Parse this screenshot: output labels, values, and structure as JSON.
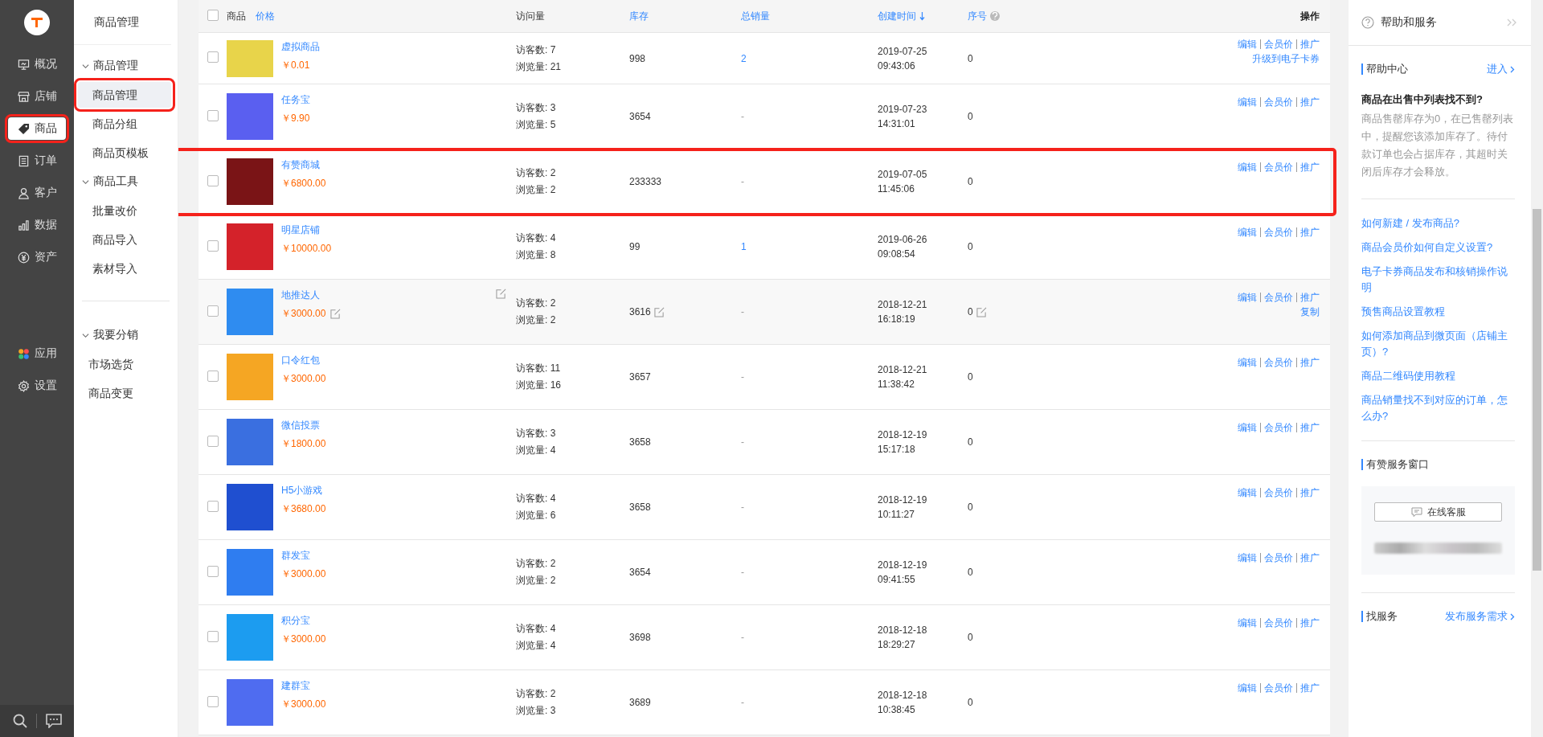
{
  "main_nav": {
    "sections": [
      {
        "items": [
          {
            "label": "概况",
            "selected": false,
            "highlighted": false
          },
          {
            "label": "店铺",
            "selected": false,
            "highlighted": false
          },
          {
            "label": "商品",
            "selected": true,
            "highlighted": true
          },
          {
            "label": "订单",
            "selected": false,
            "highlighted": false
          },
          {
            "label": "客户",
            "selected": false,
            "highlighted": false
          },
          {
            "label": "数据",
            "selected": false,
            "highlighted": false
          },
          {
            "label": "资产",
            "selected": false,
            "highlighted": false
          }
        ]
      },
      {
        "items": [
          {
            "label": "应用",
            "selected": false,
            "highlighted": false
          },
          {
            "label": "设置",
            "selected": false,
            "highlighted": false
          }
        ]
      }
    ]
  },
  "sub_nav": {
    "title": "商品管理",
    "sections": [
      {
        "groups": [
          {
            "label": "商品管理",
            "expanded": true,
            "items": [
              {
                "label": "商品管理",
                "selected": true,
                "highlighted": true
              },
              {
                "label": "商品分组",
                "selected": false,
                "highlighted": false
              },
              {
                "label": "商品页模板",
                "selected": false,
                "highlighted": false
              }
            ]
          },
          {
            "label": "商品工具",
            "expanded": true,
            "items": [
              {
                "label": "批量改价",
                "selected": false,
                "highlighted": false
              },
              {
                "label": "商品导入",
                "selected": false,
                "highlighted": false
              },
              {
                "label": "素材导入",
                "selected": false,
                "highlighted": false
              }
            ]
          }
        ]
      },
      {
        "groups": [
          {
            "label": "我要分销",
            "expanded": true,
            "items": [
              {
                "label": "市场选货",
                "selected": false,
                "highlighted": false
              },
              {
                "label": "商品变更",
                "selected": false,
                "highlighted": false
              }
            ]
          }
        ]
      }
    ]
  },
  "table": {
    "select_all_checked": false,
    "columns": [
      {
        "label": "商品",
        "sortable": false,
        "sorted_desc": false,
        "help": false
      },
      {
        "label": "价格",
        "sortable": true,
        "sorted_desc": false,
        "help": false
      },
      {
        "label": "访问量",
        "sortable": false,
        "sorted_desc": false,
        "help": false
      },
      {
        "label": "库存",
        "sortable": true,
        "sorted_desc": false,
        "help": false
      },
      {
        "label": "总销量",
        "sortable": true,
        "sorted_desc": false,
        "help": false
      },
      {
        "label": "创建时间",
        "sortable": true,
        "sorted_desc": true,
        "help": false
      },
      {
        "label": "序号",
        "sortable": true,
        "sorted_desc": false,
        "help": true
      },
      {
        "label": "操作",
        "sortable": false,
        "sorted_desc": false,
        "help": false
      }
    ],
    "rows": [
      {
        "name": "虚拟商品",
        "price": "￥0.01",
        "color": "#e8d44a",
        "visitors": "访客数: 7",
        "views": "浏览量: 21",
        "stock": "998",
        "sales": "2",
        "sales_linked": true,
        "date": "2019-07-25",
        "time": "09:43:06",
        "seq": "0",
        "actions": [
          "编辑",
          "会员价",
          "推广"
        ],
        "extra_actions": [
          "升级到电子卡券"
        ],
        "highlighted": false,
        "hovered": false,
        "checked": false
      },
      {
        "name": "任务宝",
        "price": "￥9.90",
        "color": "#5a5ff0",
        "visitors": "访客数: 3",
        "views": "浏览量: 5",
        "stock": "3654",
        "sales": "-",
        "sales_linked": false,
        "date": "2019-07-23",
        "time": "14:31:01",
        "seq": "0",
        "actions": [
          "编辑",
          "会员价",
          "推广"
        ],
        "extra_actions": [],
        "highlighted": false,
        "hovered": false,
        "checked": false
      },
      {
        "name": "有赞商城",
        "price": "￥6800.00",
        "color": "#7a1416",
        "visitors": "访客数: 2",
        "views": "浏览量: 2",
        "stock": "233333",
        "sales": "-",
        "sales_linked": false,
        "date": "2019-07-05",
        "time": "11:45:06",
        "seq": "0",
        "actions": [
          "编辑",
          "会员价",
          "推广"
        ],
        "extra_actions": [],
        "highlighted": true,
        "hovered": false,
        "checked": false
      },
      {
        "name": "明星店铺",
        "price": "￥10000.00",
        "color": "#d4222a",
        "visitors": "访客数: 4",
        "views": "浏览量: 8",
        "stock": "99",
        "sales": "1",
        "sales_linked": true,
        "date": "2019-06-26",
        "time": "09:08:54",
        "seq": "0",
        "actions": [
          "编辑",
          "会员价",
          "推广"
        ],
        "extra_actions": [],
        "highlighted": false,
        "hovered": false,
        "checked": false
      },
      {
        "name": "地推达人",
        "price": "￥3000.00",
        "color": "#2f8cf0",
        "visitors": "访客数: 2",
        "views": "浏览量: 2",
        "stock": "3616",
        "sales": "-",
        "sales_linked": false,
        "date": "2018-12-21",
        "time": "16:18:19",
        "seq": "0",
        "actions": [
          "编辑",
          "会员价",
          "推广"
        ],
        "extra_actions": [
          "复制"
        ],
        "highlighted": false,
        "hovered": true,
        "checked": false
      },
      {
        "name": "口令红包",
        "price": "￥3000.00",
        "color": "#f5a623",
        "visitors": "访客数: 11",
        "views": "浏览量: 16",
        "stock": "3657",
        "sales": "-",
        "sales_linked": false,
        "date": "2018-12-21",
        "time": "11:38:42",
        "seq": "0",
        "actions": [
          "编辑",
          "会员价",
          "推广"
        ],
        "extra_actions": [],
        "highlighted": false,
        "hovered": false,
        "checked": false
      },
      {
        "name": "微信投票",
        "price": "￥1800.00",
        "color": "#3a6fe0",
        "visitors": "访客数: 3",
        "views": "浏览量: 4",
        "stock": "3658",
        "sales": "-",
        "sales_linked": false,
        "date": "2018-12-19",
        "time": "15:17:18",
        "seq": "0",
        "actions": [
          "编辑",
          "会员价",
          "推广"
        ],
        "extra_actions": [],
        "highlighted": false,
        "hovered": false,
        "checked": false
      },
      {
        "name": "H5小游戏",
        "price": "￥3680.00",
        "color": "#1f4fd0",
        "visitors": "访客数: 4",
        "views": "浏览量: 6",
        "stock": "3658",
        "sales": "-",
        "sales_linked": false,
        "date": "2018-12-19",
        "time": "10:11:27",
        "seq": "0",
        "actions": [
          "编辑",
          "会员价",
          "推广"
        ],
        "extra_actions": [],
        "highlighted": false,
        "hovered": false,
        "checked": false
      },
      {
        "name": "群发宝",
        "price": "￥3000.00",
        "color": "#2f7df0",
        "visitors": "访客数: 2",
        "views": "浏览量: 2",
        "stock": "3654",
        "sales": "-",
        "sales_linked": false,
        "date": "2018-12-19",
        "time": "09:41:55",
        "seq": "0",
        "actions": [
          "编辑",
          "会员价",
          "推广"
        ],
        "extra_actions": [],
        "highlighted": false,
        "hovered": false,
        "checked": false
      },
      {
        "name": "积分宝",
        "price": "￥3000.00",
        "color": "#1c9cf0",
        "visitors": "访客数: 4",
        "views": "浏览量: 4",
        "stock": "3698",
        "sales": "-",
        "sales_linked": false,
        "date": "2018-12-18",
        "time": "18:29:27",
        "seq": "0",
        "actions": [
          "编辑",
          "会员价",
          "推广"
        ],
        "extra_actions": [],
        "highlighted": false,
        "hovered": false,
        "checked": false
      },
      {
        "name": "建群宝",
        "price": "￥3000.00",
        "color": "#4f6cf0",
        "visitors": "访客数: 2",
        "views": "浏览量: 3",
        "stock": "3689",
        "sales": "-",
        "sales_linked": false,
        "date": "2018-12-18",
        "time": "10:38:45",
        "seq": "0",
        "actions": [
          "编辑",
          "会员价",
          "推广"
        ],
        "extra_actions": [],
        "highlighted": false,
        "hovered": false,
        "checked": false
      }
    ]
  },
  "help_panel": {
    "title": "帮助和服务",
    "help_center": {
      "title": "帮助中心",
      "link": "进入",
      "question": "商品在出售中列表找不到?",
      "answer": "商品售罄库存为0，在已售罄列表中，提醒您该添加库存了。待付款订单也会占据库存，其超时关闭后库存才会释放。",
      "links": [
        "如何新建 / 发布商品?",
        "商品会员价如何自定义设置?",
        "电子卡券商品发布和核销操作说明",
        "预售商品设置教程",
        "如何添加商品到微页面（店铺主页）?",
        "商品二维码使用教程",
        "商品销量找不到对应的订单，怎么办?"
      ]
    },
    "service_window": {
      "title": "有赞服务窗口",
      "button": "在线客服"
    },
    "find_service": {
      "title": "找服务",
      "link": "发布服务需求"
    }
  }
}
